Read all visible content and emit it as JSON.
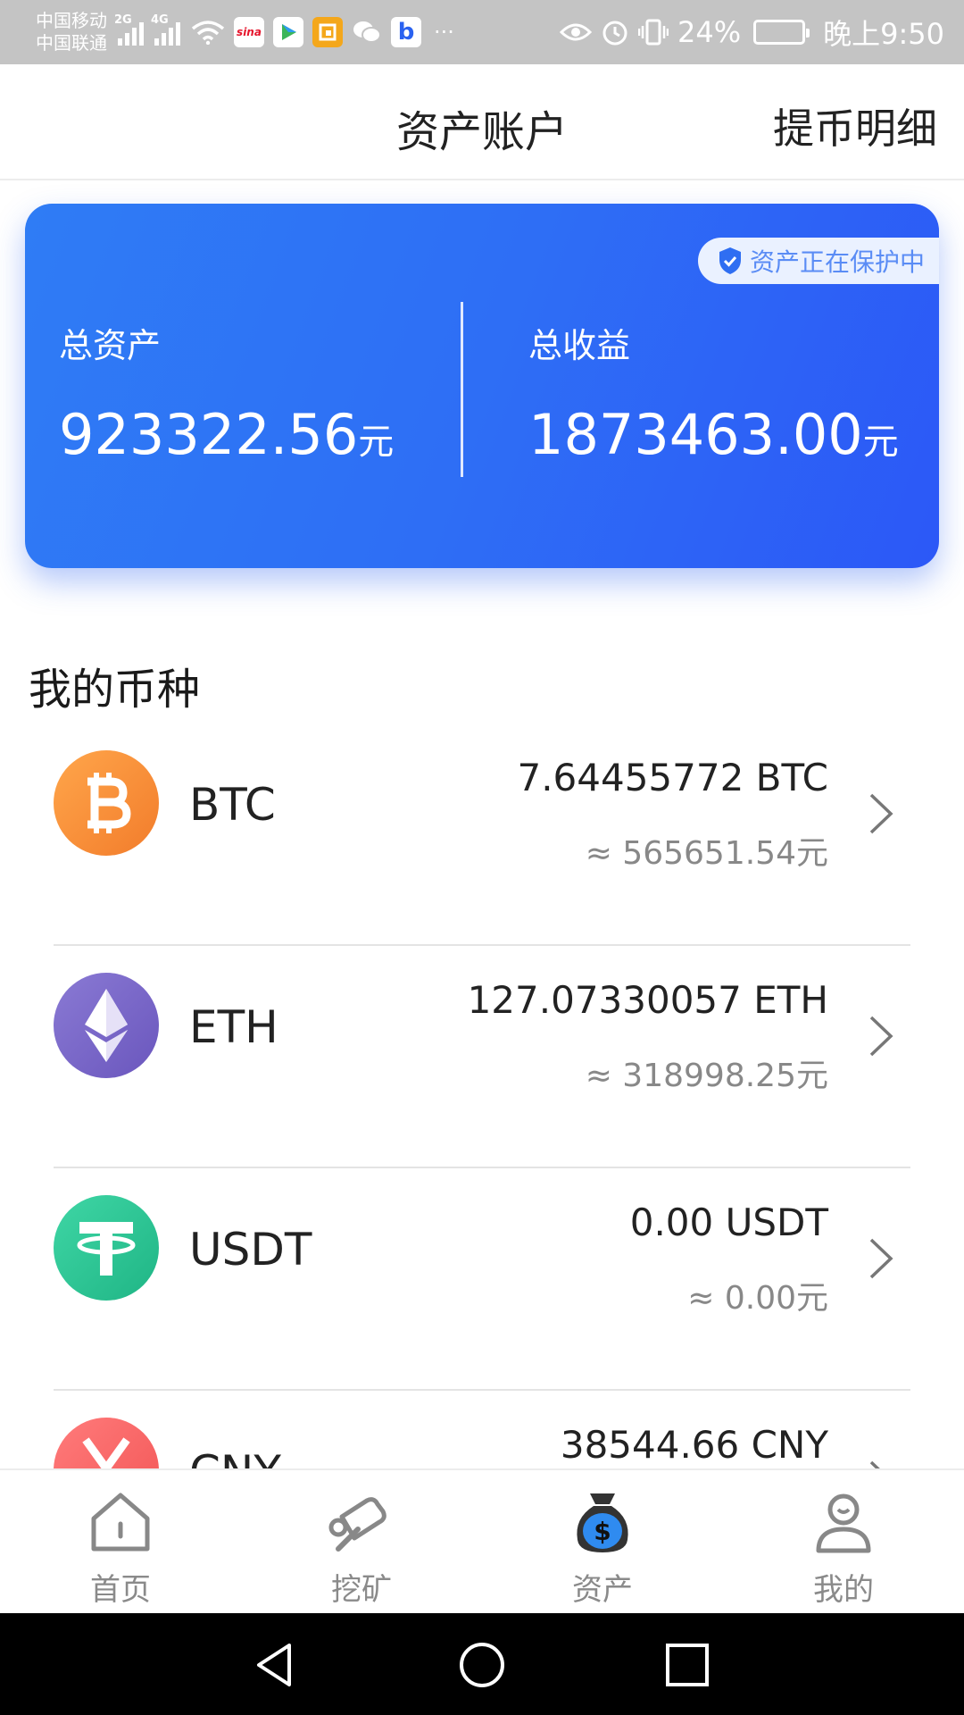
{
  "status_bar": {
    "carrier_1": "中国移动",
    "carrier_2": "中国联通",
    "signal_1_gen": "2G",
    "signal_2_gen": "4G",
    "app_icons": [
      "sina-icon",
      "play-icon",
      "yellow-app-icon",
      "wechat-icon",
      "b-app-icon"
    ],
    "sina_text": "sina",
    "b_text": "b",
    "more": "···",
    "battery": "24%",
    "time": "晚上9:50"
  },
  "header": {
    "title": "资产账户",
    "action": "提币明细"
  },
  "asset_card": {
    "badge": "资产正在保护中",
    "total_assets_label": "总资产",
    "total_assets_value": "923322.56",
    "total_assets_unit": "元",
    "total_income_label": "总收益",
    "total_income_value": "1873463.00",
    "total_income_unit": "元",
    "colors": {
      "start": "#2f7cf5",
      "end": "#2c58f7"
    }
  },
  "coins": {
    "section_title": "我的币种",
    "items": [
      {
        "name": "BTC",
        "amount": "7.64455772 BTC",
        "cny": "≈ 565651.54元",
        "icon": "bitcoin-icon",
        "color": "#f58a35"
      },
      {
        "name": "ETH",
        "amount": "127.07330057 ETH",
        "cny": "≈ 318998.25元",
        "icon": "ethereum-icon",
        "color": "#7a67c9"
      },
      {
        "name": "USDT",
        "amount": "0.00 USDT",
        "cny": "≈ 0.00元",
        "icon": "tether-icon",
        "color": "#2bc596"
      },
      {
        "name": "CNY",
        "amount": "38544.66 CNY",
        "cny": "",
        "icon": "yuan-icon",
        "color": "#f25f5f"
      }
    ]
  },
  "bottom_nav": {
    "items": [
      {
        "label": "首页",
        "icon": "home-icon"
      },
      {
        "label": "挖矿",
        "icon": "mining-icon"
      },
      {
        "label": "资产",
        "icon": "money-bag-icon",
        "active": true
      },
      {
        "label": "我的",
        "icon": "user-icon"
      }
    ]
  },
  "system_nav": {
    "buttons": [
      "back-triangle-icon",
      "home-circle-icon",
      "recents-square-icon"
    ]
  }
}
